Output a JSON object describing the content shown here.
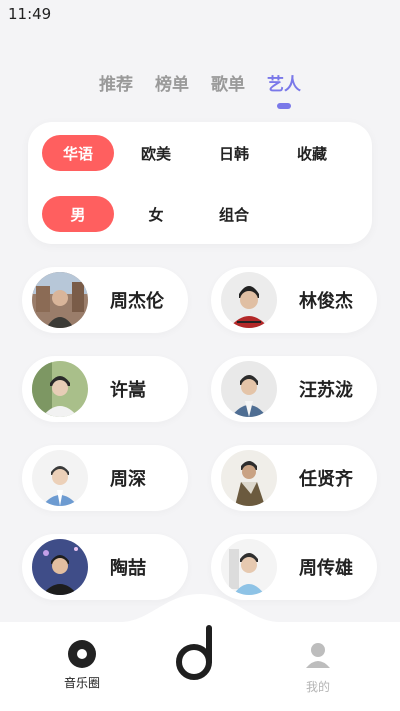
{
  "status_bar": {
    "time": "11:49"
  },
  "top_tabs": [
    {
      "label": "推荐",
      "active": false
    },
    {
      "label": "榜单",
      "active": false
    },
    {
      "label": "歌单",
      "active": false
    },
    {
      "label": "艺人",
      "active": true
    }
  ],
  "filters": {
    "region": [
      {
        "label": "华语",
        "active": true
      },
      {
        "label": "欧美",
        "active": false
      },
      {
        "label": "日韩",
        "active": false
      },
      {
        "label": "收藏",
        "active": false
      }
    ],
    "gender": [
      {
        "label": "男",
        "active": true
      },
      {
        "label": "女",
        "active": false
      },
      {
        "label": "组合",
        "active": false
      }
    ]
  },
  "artists": [
    {
      "name": "周杰伦",
      "avatar": "photo"
    },
    {
      "name": "林俊杰",
      "avatar": "photo"
    },
    {
      "name": "许嵩",
      "avatar": "photo"
    },
    {
      "name": "汪苏泷",
      "avatar": "photo"
    },
    {
      "name": "周深",
      "avatar": "photo"
    },
    {
      "name": "任贤齐",
      "avatar": "photo"
    },
    {
      "name": "陶喆",
      "avatar": "photo"
    },
    {
      "name": "周传雄",
      "avatar": "photo"
    }
  ],
  "bottom_nav": {
    "left_label": "音乐圈",
    "right_label": "我的",
    "left_icon": "disc-icon",
    "center_icon": "app-logo-icon",
    "right_icon": "profile-icon"
  },
  "colors": {
    "accent": "#7a78e9",
    "chip_active": "#ff5f5f",
    "background": "#f4f4f6"
  }
}
